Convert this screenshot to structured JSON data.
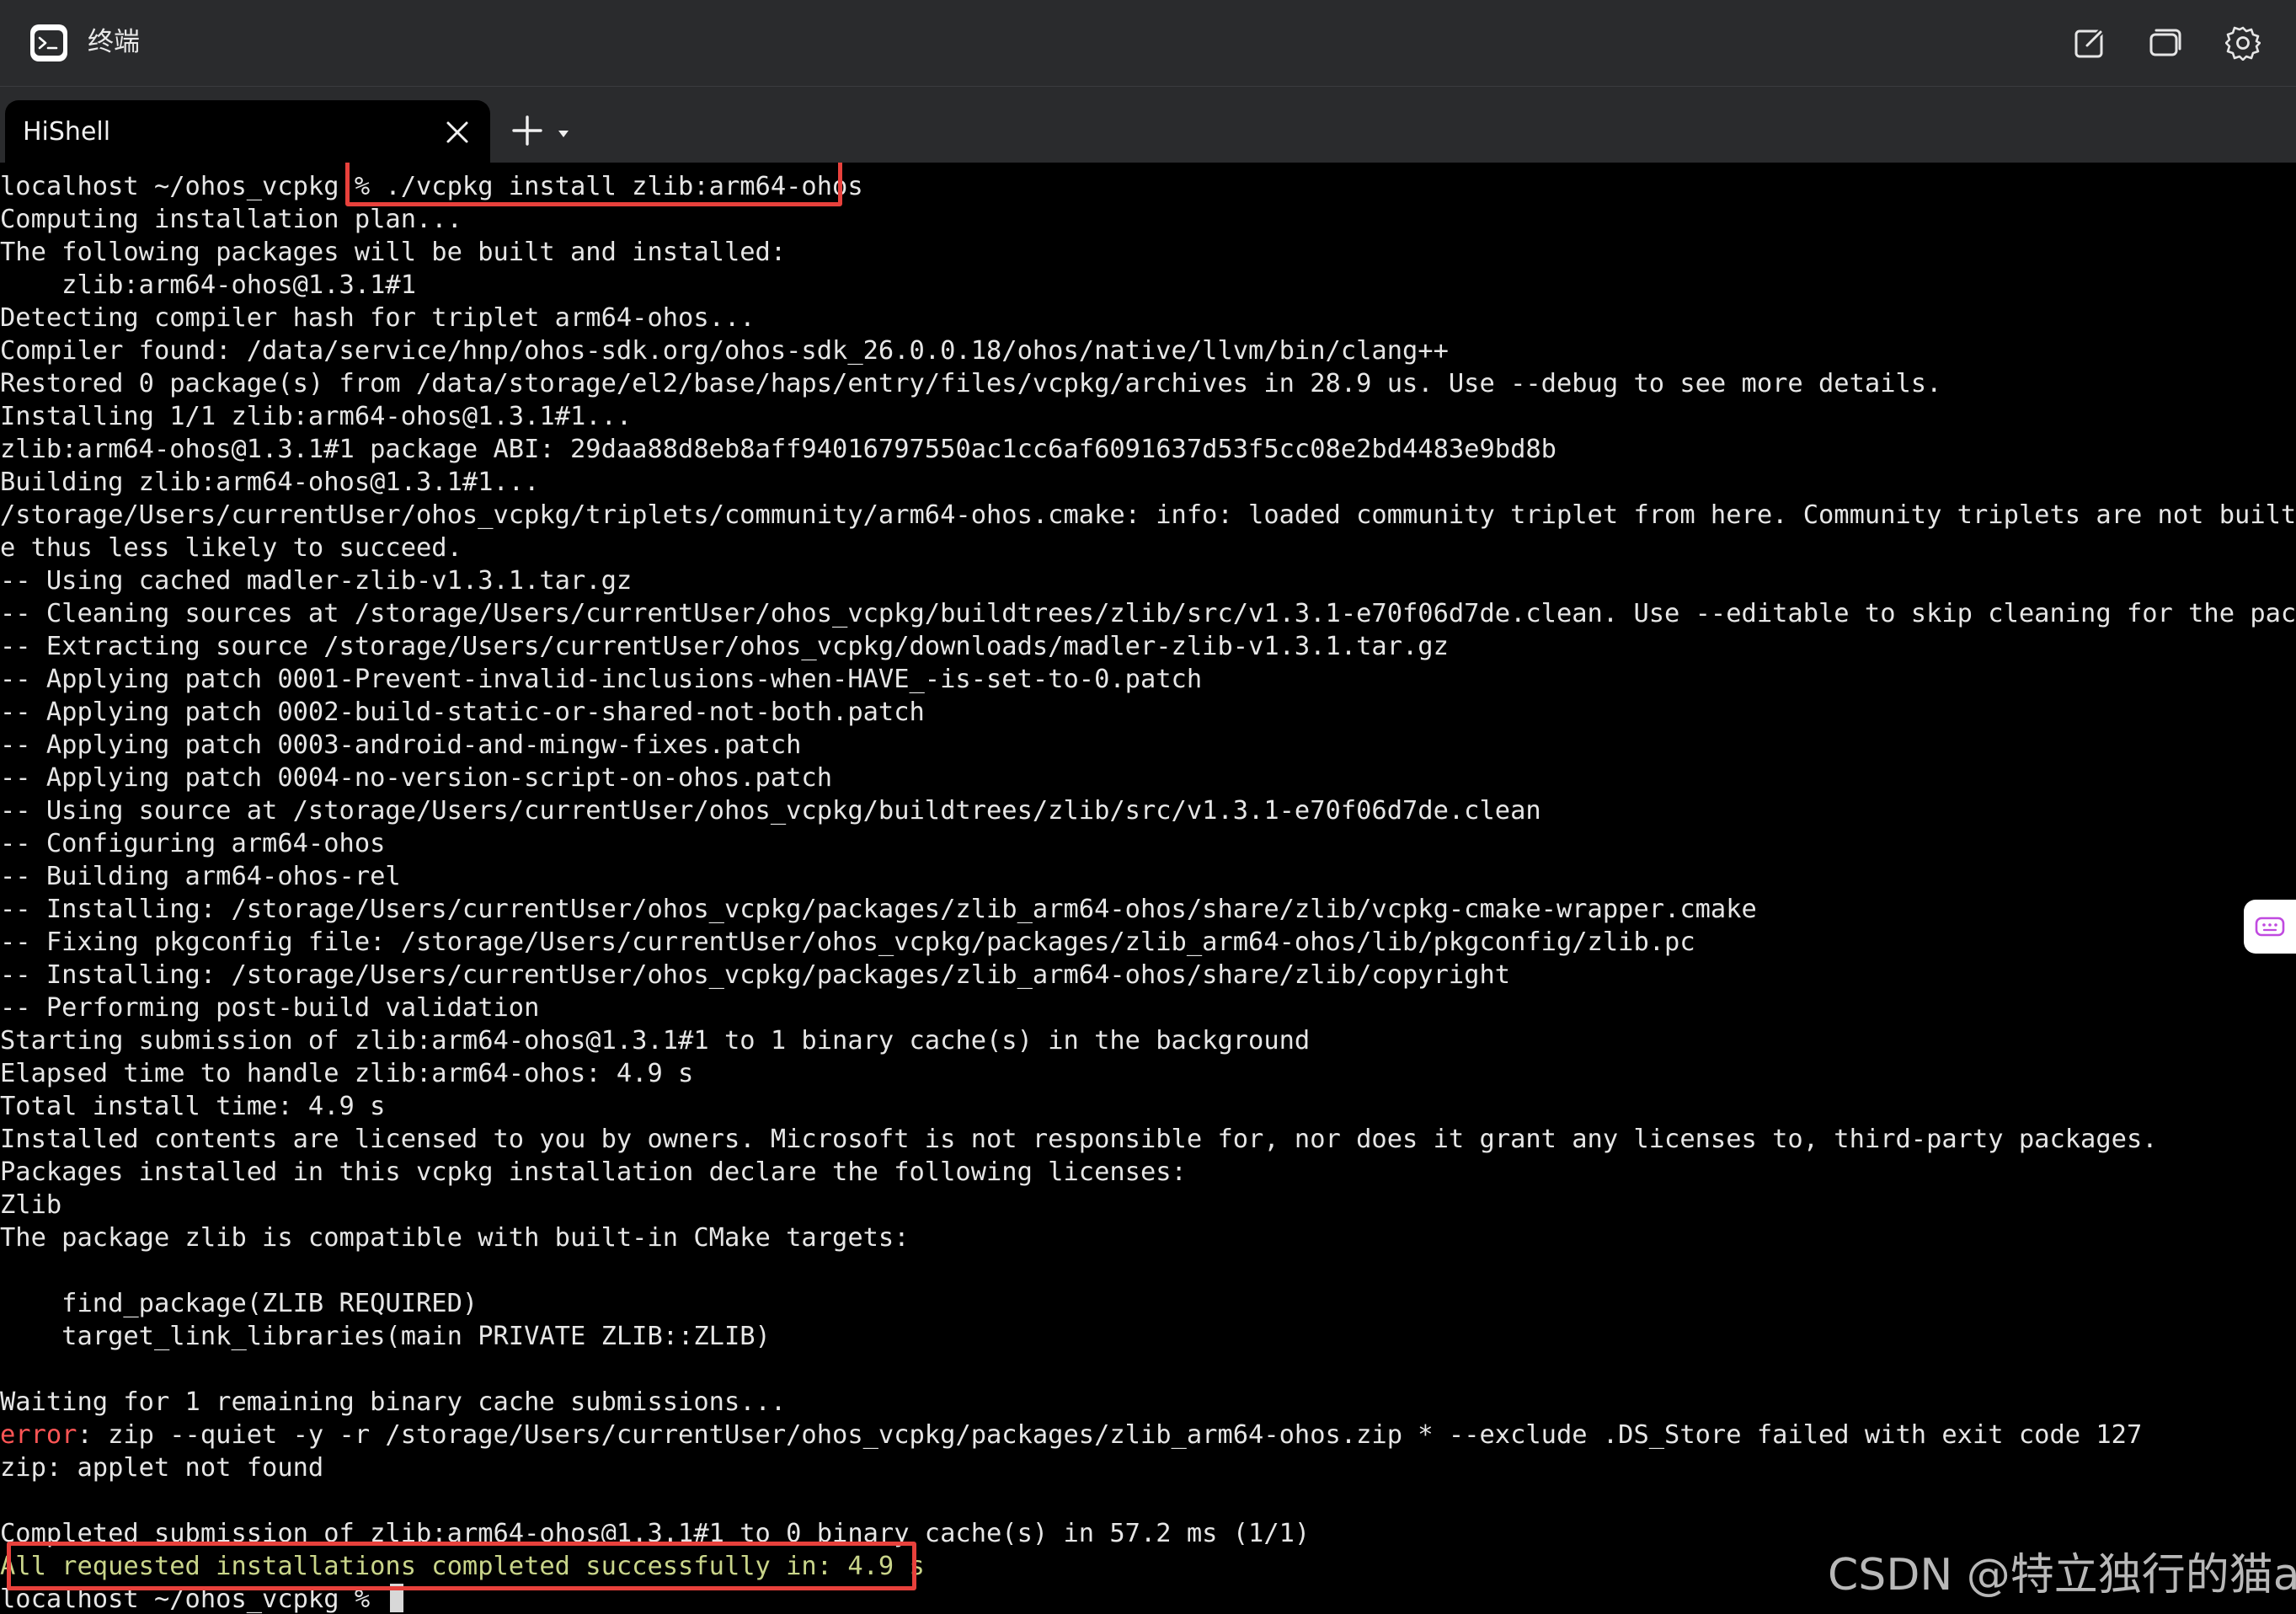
{
  "window": {
    "title": "终端",
    "icons": {
      "app": "terminal-app-icon",
      "edit": "new-window-icon",
      "windows": "window-switch-icon",
      "settings": "gear-icon"
    }
  },
  "tabs": [
    {
      "label": "HiShell",
      "active": true
    }
  ],
  "tab_actions": {
    "new_tab_icon": "plus-icon",
    "dropdown_icon": "caret-down-icon"
  },
  "terminal": {
    "lines": [
      "localhost ~/ohos_vcpkg % ./vcpkg install zlib:arm64-ohos",
      "Computing installation plan...",
      "The following packages will be built and installed:",
      "    zlib:arm64-ohos@1.3.1#1",
      "Detecting compiler hash for triplet arm64-ohos...",
      "Compiler found: /data/service/hnp/ohos-sdk.org/ohos-sdk_26.0.0.18/ohos/native/llvm/bin/clang++",
      "Restored 0 package(s) from /data/storage/el2/base/haps/entry/files/vcpkg/archives in 28.9 us. Use --debug to see more details.",
      "Installing 1/1 zlib:arm64-ohos@1.3.1#1...",
      "zlib:arm64-ohos@1.3.1#1 package ABI: 29daa88d8eb8aff94016797550ac1cc6af6091637d53f5cc08e2bd4483e9bd8b",
      "Building zlib:arm64-ohos@1.3.1#1...",
      "/storage/Users/currentUser/ohos_vcpkg/triplets/community/arm64-ohos.cmake: info: loaded community triplet from here. Community triplets are not built in the cura",
      "e thus less likely to succeed.",
      "-- Using cached madler-zlib-v1.3.1.tar.gz",
      "-- Cleaning sources at /storage/Users/currentUser/ohos_vcpkg/buildtrees/zlib/src/v1.3.1-e70f06d7de.clean. Use --editable to skip cleaning for the packages you sp",
      "-- Extracting source /storage/Users/currentUser/ohos_vcpkg/downloads/madler-zlib-v1.3.1.tar.gz",
      "-- Applying patch 0001-Prevent-invalid-inclusions-when-HAVE_-is-set-to-0.patch",
      "-- Applying patch 0002-build-static-or-shared-not-both.patch",
      "-- Applying patch 0003-android-and-mingw-fixes.patch",
      "-- Applying patch 0004-no-version-script-on-ohos.patch",
      "-- Using source at /storage/Users/currentUser/ohos_vcpkg/buildtrees/zlib/src/v1.3.1-e70f06d7de.clean",
      "-- Configuring arm64-ohos",
      "-- Building arm64-ohos-rel",
      "-- Installing: /storage/Users/currentUser/ohos_vcpkg/packages/zlib_arm64-ohos/share/zlib/vcpkg-cmake-wrapper.cmake",
      "-- Fixing pkgconfig file: /storage/Users/currentUser/ohos_vcpkg/packages/zlib_arm64-ohos/lib/pkgconfig/zlib.pc",
      "-- Installing: /storage/Users/currentUser/ohos_vcpkg/packages/zlib_arm64-ohos/share/zlib/copyright",
      "-- Performing post-build validation",
      "Starting submission of zlib:arm64-ohos@1.3.1#1 to 1 binary cache(s) in the background",
      "Elapsed time to handle zlib:arm64-ohos: 4.9 s",
      "Total install time: 4.9 s",
      "Installed contents are licensed to you by owners. Microsoft is not responsible for, nor does it grant any licenses to, third-party packages.",
      "Packages installed in this vcpkg installation declare the following licenses:",
      "Zlib",
      "The package zlib is compatible with built-in CMake targets:",
      "",
      "    find_package(ZLIB REQUIRED)",
      "    target_link_libraries(main PRIVATE ZLIB::ZLIB)",
      "",
      "Waiting for 1 remaining binary cache submissions...",
      "",
      "zip: applet not found",
      "",
      "Completed submission of zlib:arm64-ohos@1.3.1#1 to 0 binary cache(s) in 57.2 ms (1/1)",
      "",
      ""
    ],
    "error_line": {
      "prefix": "error",
      "rest": ": zip --quiet -y -r /storage/Users/currentUser/ohos_vcpkg/packages/zlib_arm64-ohos.zip * --exclude .DS_Store failed with exit code 127"
    },
    "success_line": "All requested installations completed successfully in: 4.9 s",
    "prompt_line": "localhost ~/ohos_vcpkg % ",
    "colors": {
      "text": "#e6e6e6",
      "error": "#ff5555",
      "success": "#c9d58a",
      "highlight": "#e8413c"
    }
  },
  "side_widget_icon": "keyboard-assist-icon",
  "watermark": "CSDN @特立独行的猫a"
}
